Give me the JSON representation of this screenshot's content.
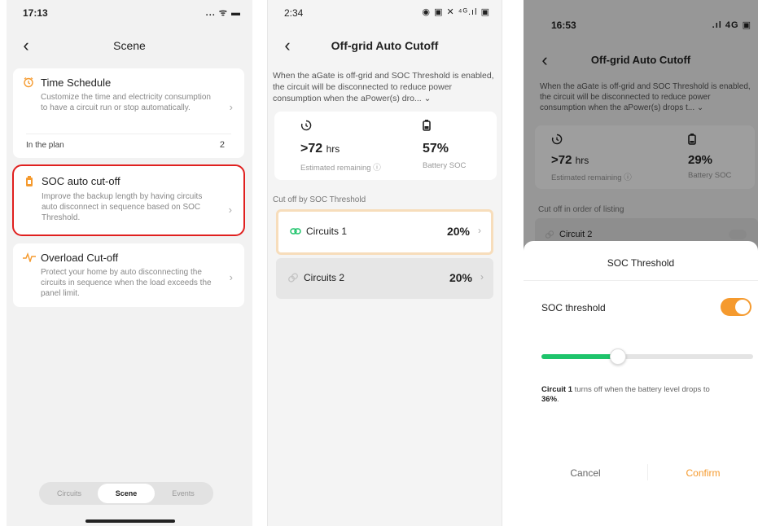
{
  "colors": {
    "accent": "#f59a2e",
    "slider_fill": "#1ec46b",
    "highlight": "#e0201f",
    "link": "#f59a2e"
  },
  "screen1": {
    "status_time": "17:13",
    "status_right": "... ᯤ ▬",
    "nav_title": "Scene",
    "cards": [
      {
        "title": "Time Schedule",
        "desc": "Customize the time and electricity consumption to have a circuit run or stop automatically.",
        "icon": "clock-icon",
        "sub_label": "In the plan",
        "sub_value": "2"
      },
      {
        "title": "SOC auto cut-off",
        "desc": "Improve the backup length by having circuits auto disconnect in sequence based on SOC Threshold.",
        "icon": "battery-icon"
      },
      {
        "title": "Overload Cut-off",
        "desc": "Protect your home by auto disconnecting the circuits in sequence when the load exceeds the panel limit.",
        "icon": "pulse-icon"
      }
    ],
    "tabs": [
      "Circuits",
      "Scene",
      "Events"
    ]
  },
  "screen2": {
    "status_time": "2:34",
    "status_right": "◉ ▣ ✕ ⁴ᴳ.ıl ▣",
    "nav_title": "Off-grid Auto Cutoff",
    "desc": "When the aGate is off-grid and SOC Threshold is enabled, the circuit will be disconnected to reduce power consumption when the aPower(s) dro... ⌄",
    "remaining_value": ">72",
    "remaining_unit": "hrs",
    "remaining_label": "Estimated remaining ⓘ",
    "soc_value": "57%",
    "soc_label": "Battery SOC",
    "section_label": "Cut off by SOC Threshold",
    "circuits": [
      {
        "name": "Circuits 1",
        "pct": "20%"
      },
      {
        "name": "Circuits 2",
        "pct": "20%"
      }
    ]
  },
  "screen3": {
    "status_time": "16:53",
    "status_right": ".ıl 4G ▣",
    "nav_title": "Off-grid Auto Cutoff",
    "desc": "When the aGate is off-grid and SOC Threshold is enabled, the circuit will be disconnected to reduce power consumption when the aPower(s) drops t... ⌄",
    "remaining_value": ">72",
    "remaining_unit": "hrs",
    "remaining_label": "Estimated remaining ⓘ",
    "soc_value": "29%",
    "soc_label": "Battery SOC",
    "section_label": "Cut off in order of listing",
    "circuit_name": "Circuit 2",
    "sheet": {
      "title": "SOC Threshold",
      "toggle_label": "SOC threshold",
      "toggle_on": true,
      "slider_value_pct": 36,
      "note_circuit": "Circuit 1",
      "note_mid": " turns off when the battery level drops to",
      "note_value": "36%",
      "note_end": ".",
      "cancel": "Cancel",
      "confirm": "Confirm"
    }
  }
}
